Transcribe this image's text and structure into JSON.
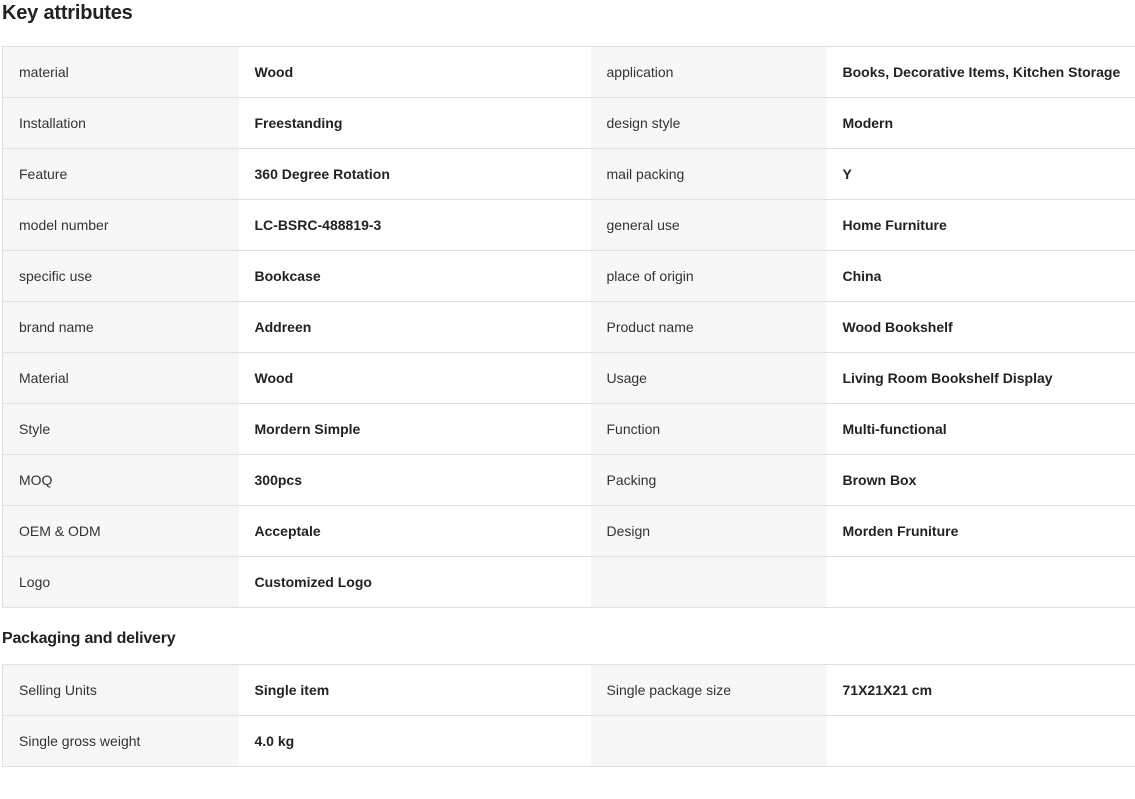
{
  "key_attributes": {
    "title": "Key attributes",
    "rows": [
      [
        {
          "k": "material",
          "v": "Wood"
        },
        {
          "k": "application",
          "v": "Books, Decorative Items, Kitchen Storage"
        }
      ],
      [
        {
          "k": "Installation",
          "v": "Freestanding"
        },
        {
          "k": "design style",
          "v": "Modern"
        }
      ],
      [
        {
          "k": "Feature",
          "v": "360 Degree Rotation"
        },
        {
          "k": "mail packing",
          "v": "Y"
        }
      ],
      [
        {
          "k": "model number",
          "v": "LC-BSRC-488819-3"
        },
        {
          "k": "general use",
          "v": "Home Furniture"
        }
      ],
      [
        {
          "k": "specific use",
          "v": "Bookcase"
        },
        {
          "k": "place of origin",
          "v": "China"
        }
      ],
      [
        {
          "k": "brand name",
          "v": "Addreen"
        },
        {
          "k": "Product name",
          "v": "Wood Bookshelf"
        }
      ],
      [
        {
          "k": "Material",
          "v": "Wood"
        },
        {
          "k": "Usage",
          "v": "Living Room Bookshelf Display"
        }
      ],
      [
        {
          "k": "Style",
          "v": "Mordern Simple"
        },
        {
          "k": "Function",
          "v": "Multi-functional"
        }
      ],
      [
        {
          "k": "MOQ",
          "v": "300pcs"
        },
        {
          "k": "Packing",
          "v": "Brown Box"
        }
      ],
      [
        {
          "k": "OEM & ODM",
          "v": "Acceptale"
        },
        {
          "k": "Design",
          "v": "Morden Fruniture"
        }
      ],
      [
        {
          "k": "Logo",
          "v": "Customized Logo"
        },
        {
          "k": "",
          "v": ""
        }
      ]
    ]
  },
  "packaging": {
    "title": "Packaging and delivery",
    "rows": [
      [
        {
          "k": "Selling Units",
          "v": "Single item"
        },
        {
          "k": "Single package size",
          "v": "71X21X21 cm"
        }
      ],
      [
        {
          "k": "Single gross weight",
          "v": "4.0 kg"
        },
        {
          "k": "",
          "v": ""
        }
      ]
    ]
  }
}
